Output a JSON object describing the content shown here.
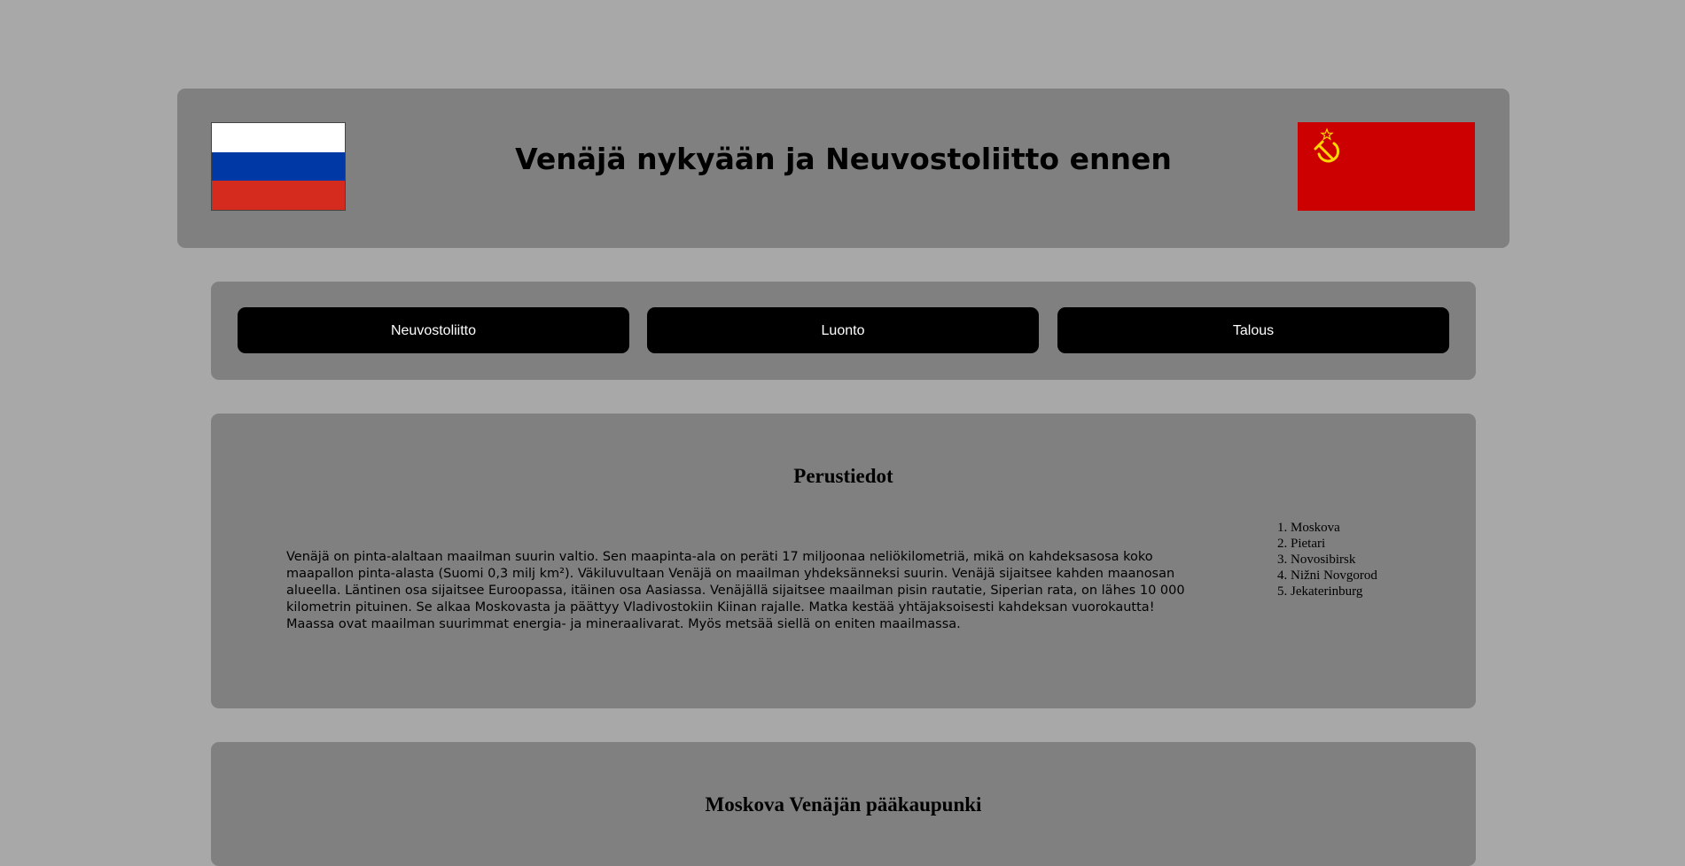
{
  "header": {
    "title": "Venäjä nykyään ja Neuvostoliitto ennen",
    "flag_left": "russia-flag",
    "flag_right": "soviet-union-flag"
  },
  "nav": {
    "items": [
      {
        "label": "Neuvostoliitto"
      },
      {
        "label": "Luonto"
      },
      {
        "label": "Talous"
      }
    ]
  },
  "basics": {
    "title": "Perustiedot",
    "text": "Venäjä on pinta-alaltaan maailman suurin valtio. Sen maapinta-ala on peräti 17 miljoonaa neliökilometriä, mikä on kahdeksasosa koko maapallon pinta-alasta (Suomi 0,3 milj km²). Väkiluvultaan Venäjä on maailman yhdeksänneksi suurin. Venäjä sijaitsee kahden maanosan alueella. Läntinen osa sijaitsee Euroopassa, itäinen osa Aasiassa. Venäjällä sijaitsee maailman pisin rautatie, Siperian rata, on lähes 10 000 kilometrin pituinen. Se alkaa Moskovasta ja päättyy Vladivostokiin Kiinan rajalle. Matka kestää yhtäjaksoisesti kahdeksan vuorokautta! Maassa ovat maailman suurimmat energia- ja mineraalivarat. Myös metsää siellä on eniten maailmassa.",
    "cities": [
      "Moskova",
      "Pietari",
      "Novosibirsk",
      "Nižni Novgorod",
      "Jekaterinburg"
    ]
  },
  "moscow": {
    "title": "Moskova Venäjän pääkaupunki"
  },
  "colors": {
    "page_bg": "#a8a8a8",
    "panel_bg": "#808080",
    "button_bg": "#000000",
    "button_text": "#ffffff",
    "ru_white": "#ffffff",
    "ru_blue": "#0039a6",
    "ru_red": "#d52b1e",
    "su_red": "#cc0000",
    "su_gold": "#ffd700"
  }
}
